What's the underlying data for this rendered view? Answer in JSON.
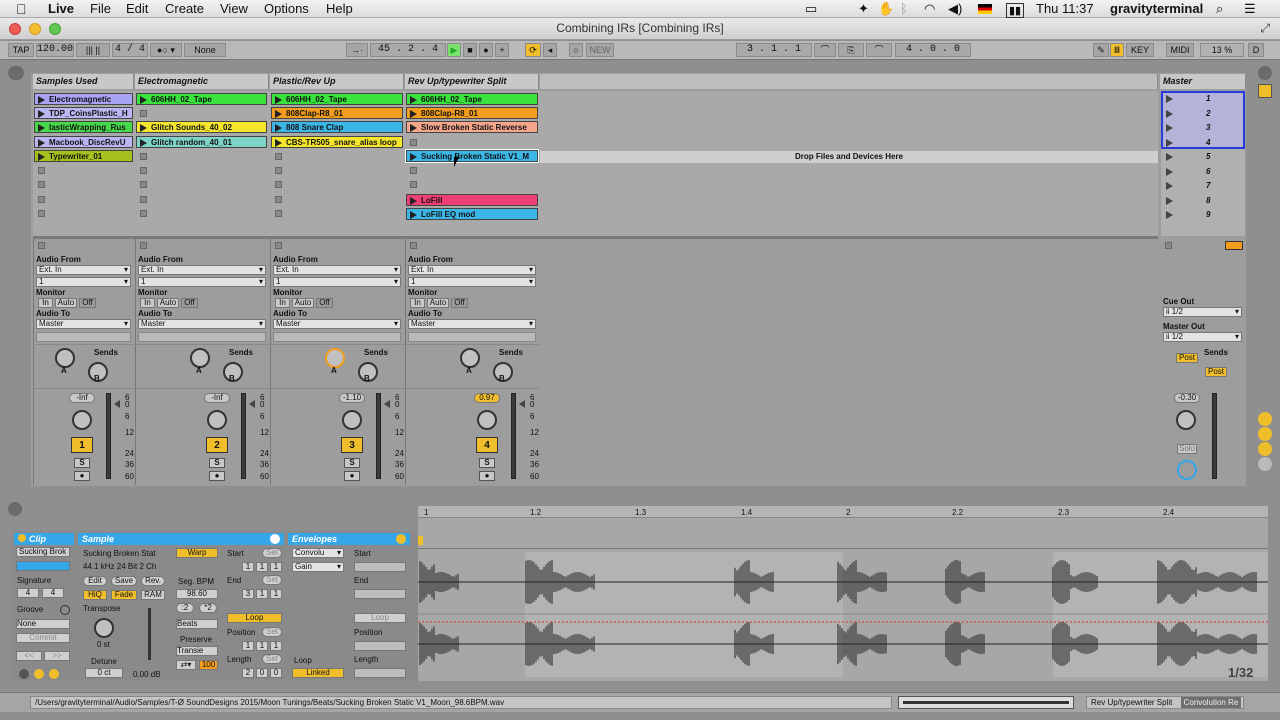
{
  "menubar": {
    "app": "Live",
    "items": [
      "File",
      "Edit",
      "Create",
      "View",
      "Options",
      "Help"
    ],
    "clock": "Thu 11:37",
    "user": "gravityterminal"
  },
  "window": {
    "title": "Combining IRs  [Combining IRs]"
  },
  "transport": {
    "tap": "TAP",
    "tempo": "120.00",
    "signature": "4 / 4",
    "quantize": "None",
    "position": "45 .  2 .  4",
    "new": "NEW",
    "loop_start": "3 .  1 .  1",
    "loop_length": "4 .  0 .  0",
    "key": "KEY",
    "midi": "MIDI",
    "cpu": "13 %",
    "d": "D"
  },
  "tracks": [
    {
      "name": "Samples Used",
      "clips": [
        {
          "label": "Electromagnetic",
          "color": "#a8a3f5"
        },
        {
          "label": "TDP_CoinsPlastic_H",
          "color": "#b9b6f2"
        },
        {
          "label": "lasticWrapping_Rus",
          "color": "#48d94b"
        },
        {
          "label": "Macbook_DiscRevU",
          "color": "#b8b5f0"
        },
        {
          "label": "Typewriter_01",
          "color": "#a8c01e"
        }
      ],
      "volume": "-Inf",
      "number": "1"
    },
    {
      "name": "Electromagnetic",
      "clips": [
        {
          "label": "606HH_02_Tape",
          "color": "#39e23d"
        },
        {
          "label": "",
          "color": ""
        },
        {
          "label": "Glitch Sounds_40_02",
          "color": "#f3e62c"
        },
        {
          "label": "Glitch random_40_01",
          "color": "#7ed3c9"
        }
      ],
      "volume": "-Inf",
      "number": "2"
    },
    {
      "name": "Plastic/Rev Up",
      "clips": [
        {
          "label": "606HH_02_Tape",
          "color": "#39e23d"
        },
        {
          "label": "808Clap-R8_01",
          "color": "#f39d1e"
        },
        {
          "label": "808 Snare Clap",
          "color": "#3bb6e6"
        },
        {
          "label": "CBS-TR505_snare_alias loop",
          "color": "#f3e62c"
        }
      ],
      "volume": "-1.10",
      "number": "3"
    },
    {
      "name": "Rev Up/typewriter Split",
      "clips": [
        {
          "label": "606HH_02_Tape",
          "color": "#39e23d"
        },
        {
          "label": "808Clap-R8_01",
          "color": "#f39d1e"
        },
        {
          "label": "Slow Broken Static Reverse",
          "color": "#f5a58a"
        },
        {
          "label": "Sucking Broken Static V1_M",
          "color": "#3bb6e6"
        },
        {
          "label": "LoFill",
          "color": "#ef3f74"
        },
        {
          "label": "LoFill EQ mod",
          "color": "#3bb6e6"
        }
      ],
      "volume": "0.97",
      "number": "4"
    }
  ],
  "io": {
    "audio_from": "Audio From",
    "ext_in": "Ext. In",
    "channel": "1",
    "monitor": "Monitor",
    "in": "In",
    "auto": "Auto",
    "off": "Off",
    "audio_to": "Audio To",
    "master": "Master",
    "sends": "Sends",
    "a": "A",
    "b": "B",
    "s": "S"
  },
  "master": {
    "name": "Master",
    "scenes": [
      "1",
      "2",
      "3",
      "4",
      "5",
      "6",
      "7",
      "8",
      "9"
    ],
    "cue_out": "Cue Out",
    "cue_val": "ii 1/2",
    "master_out": "Master Out",
    "master_val": "ii 1/2",
    "post": "Post",
    "sends": "Sends",
    "volume": "-0.30",
    "solo": "Solo"
  },
  "drop_text": "Drop Files and Devices Here",
  "meter_scale": [
    "6",
    "0",
    "6",
    "12",
    "24",
    "36",
    "60"
  ],
  "detail": {
    "clip": {
      "title": "Clip",
      "name": "Sucking Brok",
      "signature": "Signature",
      "sig_num": "4",
      "sig_den": "4",
      "groove": "Groove",
      "groove_val": "None",
      "commit": "Commit",
      "nav_left": "<<",
      "nav_right": ">>"
    },
    "sample": {
      "title": "Sample",
      "name": "Sucking Broken Stat",
      "info": "44.1 kHz 24 Bit 2 Ch",
      "edit": "Edit",
      "save": "Save",
      "rev": "Rev.",
      "hiq": "HiQ",
      "fade": "Fade",
      "ram": "RAM",
      "transpose": "Transpose",
      "transpose_val": "0 st",
      "detune": "Detune",
      "detune_val": "0 ct",
      "gain_val": "0.00 dB",
      "warp": "Warp",
      "seg_bpm": "Seg. BPM",
      "bpm_val": "98.60",
      "half": ":2",
      "double": "*2",
      "mode": "Beats",
      "preserve": "Preserve",
      "preserve_val": "Transie",
      "hundred": "100",
      "start": "Start",
      "set": "Set",
      "end": "End",
      "loop": "Loop",
      "position": "Position",
      "length": "Length",
      "start_val": [
        "1",
        "1",
        "1"
      ],
      "end_val": [
        "3",
        "1",
        "1"
      ],
      "pos_val": [
        "1",
        "1",
        "1"
      ],
      "len_val": [
        "2",
        "0",
        "0"
      ]
    },
    "envelopes": {
      "title": "Envelopes",
      "device": "Convolu",
      "param": "Gain",
      "start": "Start",
      "end": "End",
      "loop_btn": "Loop",
      "position": "Position",
      "length": "Length",
      "loop": "Loop",
      "linked": "Linked"
    },
    "ruler": [
      "1",
      "1.2",
      "1.3",
      "1.4",
      "2",
      "2.2",
      "2.3",
      "2.4"
    ],
    "zoom": "1/32"
  },
  "status": {
    "path": "/Users/gravityterminal/Audio/Samples/T-Ø SoundDesigns 2015/Moon Tunings/Beats/Sucking Broken Static V1_Moon_98.6BPM.wav",
    "track": "Rev Up/typewriter Split",
    "device": "Convolution Re"
  },
  "colors": {
    "accent": "#f0be2b",
    "selection": "#35a6e8"
  }
}
